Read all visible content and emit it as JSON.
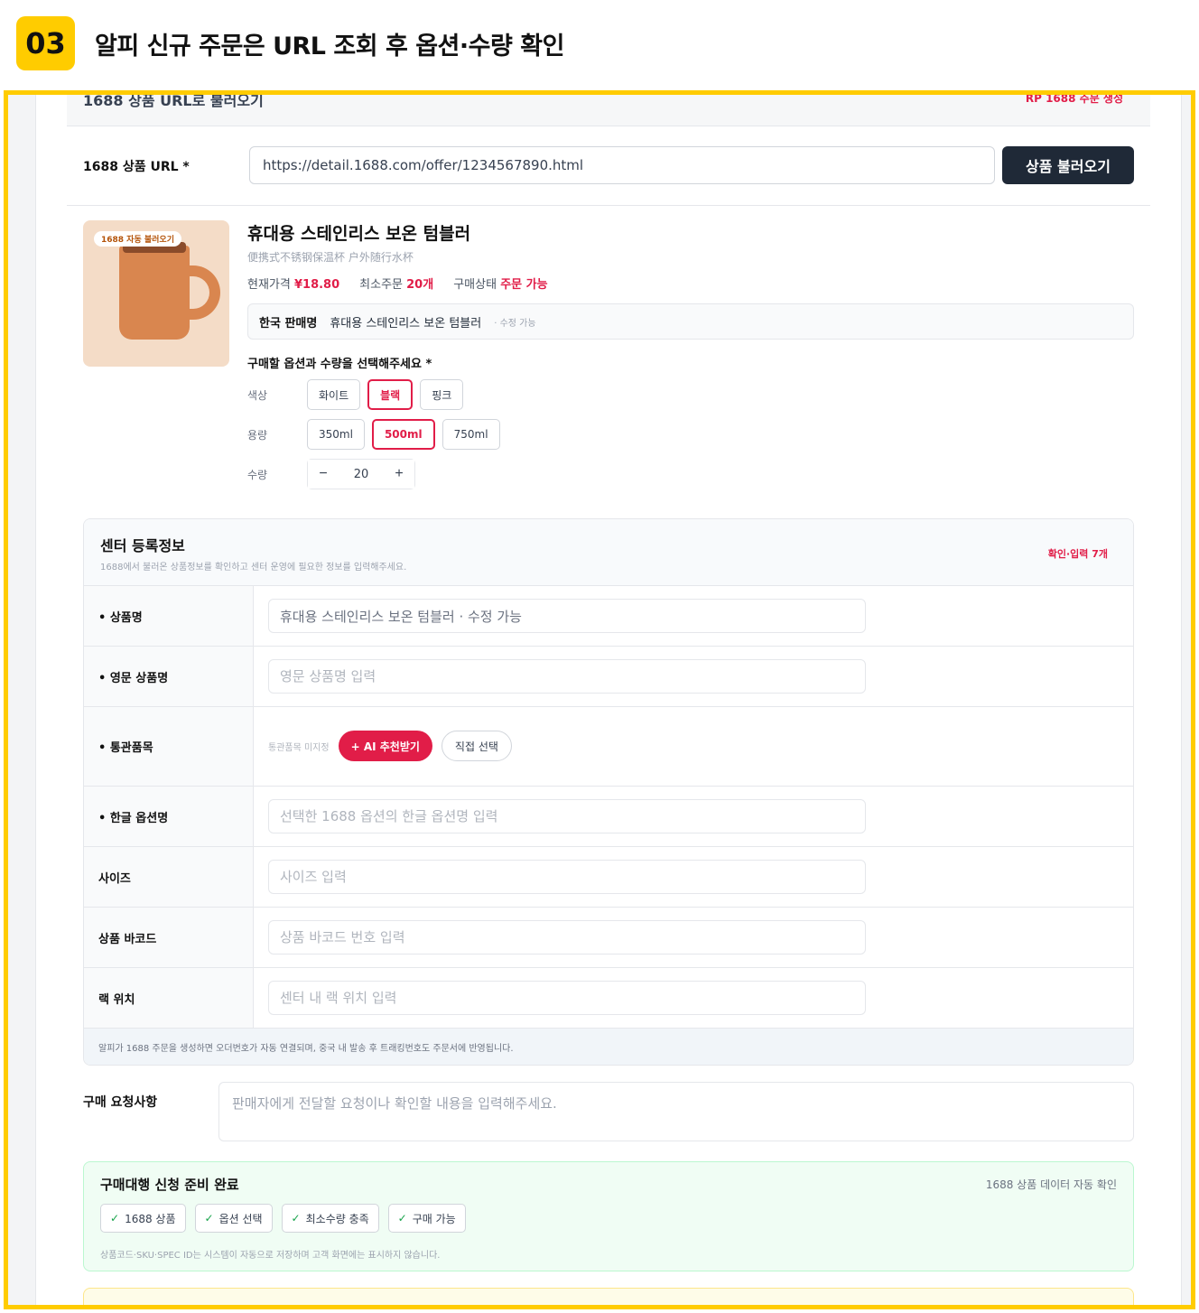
{
  "step": {
    "number": "03",
    "title": "알피 신규 주문은 URL 조회 후 옵션·수량 확인"
  },
  "panel": {
    "title": "1688 상품 URL로 불러오기",
    "note": "RP 1688 주문 생성"
  },
  "url_row": {
    "label": "1688 상품 URL *",
    "value": "https://detail.1688.com/offer/1234567890.html",
    "button": "상품 불러오기"
  },
  "product": {
    "thumb_tag": "1688 자동 불러오기",
    "name": "휴대용 스테인리스 보온 텀블러",
    "cn_name": "便携式不锈钢保温杯 户外随行水杯",
    "price_label": "현재가격",
    "price": "¥18.80",
    "moq_label": "최소주문",
    "moq": "20개",
    "status_label": "구매상태",
    "status": "주문 가능",
    "korean_seller_label": "한국 판매명",
    "korean_seller_value": "휴대용 스테인리스 보온 텀블러",
    "korean_seller_note": "· 수정 가능",
    "options_title": "구매할 옵션과 수량을 선택해주세요 *",
    "color_label": "색상",
    "colors": [
      "화이트",
      "블랙",
      "핑크"
    ],
    "color_selected": "블랙",
    "capacity_label": "용량",
    "capacities": [
      "350ml",
      "500ml",
      "750ml"
    ],
    "capacity_selected": "500ml",
    "qty_label": "수량",
    "qty": "20",
    "minus": "−",
    "plus": "+"
  },
  "center": {
    "title": "센터 등록정보",
    "desc": "1688에서 불러온 상품정보를 확인하고 센터 운영에 필요한 정보를 입력해주세요.",
    "badge": "확인·입력 7개",
    "fields": {
      "product_name": {
        "label": "• 상품명",
        "value": "휴대용 스테인리스 보온 텀블러 · 수정 가능"
      },
      "eng_name": {
        "label": "• 영문 상품명",
        "placeholder": "영문 상품명 입력"
      },
      "hs": {
        "label": "• 통관품목",
        "muted": "통관품목 미지정",
        "ai_button": "+ AI 추천받기",
        "direct_button": "직접 선택"
      },
      "kor_option": {
        "label": "• 한글 옵션명",
        "placeholder": "선택한 1688 옵션의 한글 옵션명 입력"
      },
      "size": {
        "label": "사이즈",
        "placeholder": "사이즈 입력"
      },
      "barcode": {
        "label": "상품 바코드",
        "placeholder": "상품 바코드 번호 입력"
      },
      "rack": {
        "label": "랙 위치",
        "placeholder": "센터 내 랙 위치 입력"
      }
    },
    "footer": "알피가 1688 주문을 생성하면 오더번호가 자동 연결되며, 중국 내 발송 후 트래킹번호도 주문서에 반영됩니다."
  },
  "request": {
    "label": "구매 요청사항",
    "placeholder": "판매자에게 전달할 요청이나 확인할 내용을 입력해주세요."
  },
  "ready": {
    "title": "구매대행 신청 준비 완료",
    "note": "1688 상품 데이터 자동 확인",
    "checks": [
      "1688 상품",
      "옵션 선택",
      "최소수량 충족",
      "구매 가능"
    ],
    "check_mark": "✓",
    "footer": "상품코드·SKU·SPEC ID는 시스템이 자동으로 저장하며 고객 화면에는 표시하지 않습니다."
  },
  "colors": {
    "accent": "#FFCC00",
    "primary_red": "#e11d48",
    "dark_button": "#1f2937",
    "ready_bg": "#f0fdf4"
  }
}
